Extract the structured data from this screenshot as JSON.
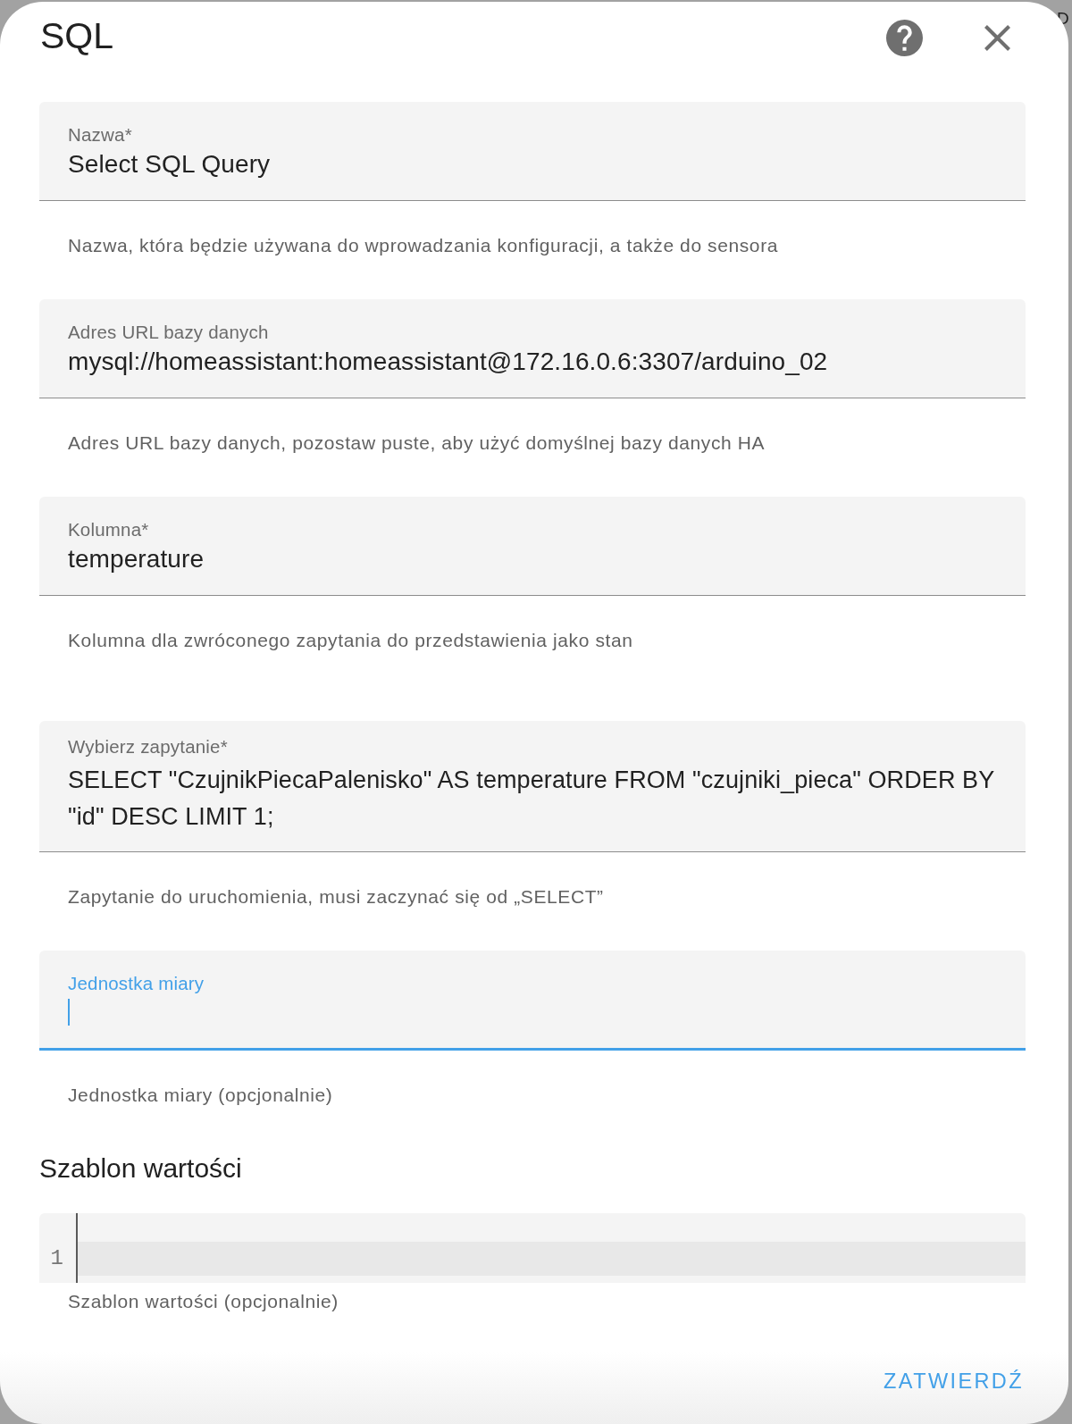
{
  "backdrop": {
    "text": "D"
  },
  "dialog": {
    "title": "SQL"
  },
  "fields": [
    {
      "kind": "text",
      "label": "Nazwa*",
      "value": "Select SQL Query",
      "helper": "Nazwa, która będzie używana do wprowadzania konfiguracji, a także do sensora",
      "focused": false
    },
    {
      "kind": "text",
      "label": "Adres URL bazy danych",
      "value": "mysql://homeassistant:homeassistant@172.16.0.6:3307/arduino_02",
      "helper": "Adres URL bazy danych, pozostaw puste, aby użyć domyślnej bazy danych HA",
      "focused": false
    },
    {
      "kind": "text",
      "label": "Kolumna*",
      "value": "temperature",
      "helper": "Kolumna dla zwróconego zapytania do przedstawienia jako stan",
      "focused": false
    },
    {
      "kind": "multiline",
      "label": "Wybierz zapytanie*",
      "value": "SELECT \"CzujnikPiecaPalenisko\" AS temperature FROM \"czujniki_pieca\" ORDER BY \"id\" DESC LIMIT 1;",
      "helper": "Zapytanie do uruchomienia, musi zaczynać się od „SELECT”",
      "focused": false
    },
    {
      "kind": "text",
      "label": "Jednostka miary",
      "helper": "Jednostka miary (opcjonalnie)",
      "focused": true
    }
  ],
  "template": {
    "heading": "Szablon wartości",
    "lines": [
      {
        "number": "1",
        "active": true
      }
    ],
    "helper": "Szablon wartości (opcjonalnie)"
  },
  "actions": [
    {
      "label": "ZATWIERDŹ"
    }
  ]
}
